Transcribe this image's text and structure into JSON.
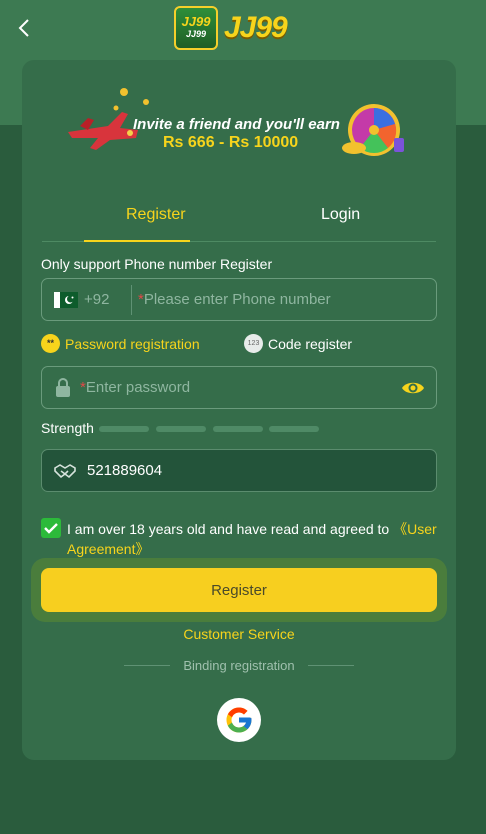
{
  "header": {
    "logo_badge_top": "JJ99",
    "logo_badge_bottom": "JJ99",
    "logo_text": "JJ99"
  },
  "banner": {
    "line1": "Invite a friend and you'll earn",
    "line2": "Rs 666 - Rs 10000"
  },
  "tabs": {
    "register": "Register",
    "login": "Login",
    "active": "Register"
  },
  "form": {
    "support_label": "Only support Phone number Register",
    "country_code": "+92",
    "phone_placeholder": "Please enter Phone number",
    "modes": {
      "password": "Password registration",
      "code": "Code register",
      "code_icon": "123",
      "password_icon": "**"
    },
    "password_placeholder": "Enter password",
    "strength_label": "Strength",
    "captcha_value": "521889604",
    "agree_text": "I am over 18 years old and have read and agreed to ",
    "agree_link": "《User Agreement》",
    "agree_checked": true,
    "register_button": "Register"
  },
  "footer": {
    "customer_service": "Customer Service",
    "binding_label": "Binding registration"
  },
  "colors": {
    "accent": "#f7d41c",
    "card": "#356d4a",
    "background": "#2a5c3d"
  }
}
